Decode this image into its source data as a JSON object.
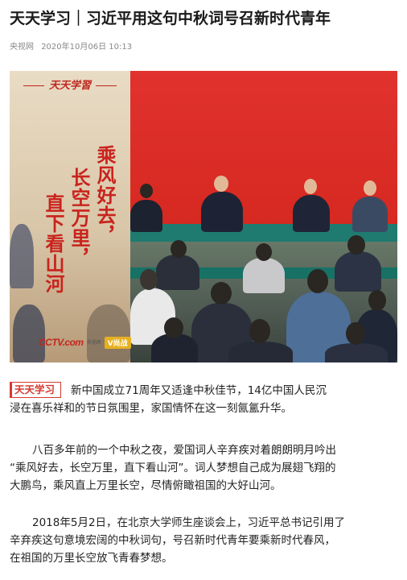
{
  "article": {
    "title": "天天学习｜习近平用这句中秋词号召新时代青年",
    "source": "央视网",
    "datetime": "2020年10月06日 10:13"
  },
  "hero": {
    "brand_text": "天天学習",
    "calligraphy_columns": [
      "乘风好去，",
      "长空万里，",
      "直下看山河"
    ],
    "logo_text": "CCTV.com",
    "logo_sub": "央视网",
    "badge_text": "V尚战",
    "colors": {
      "accent_red": "#d5281f",
      "tag_red": "#d63a2f"
    }
  },
  "body": {
    "tag_label": "天天学习",
    "paragraphs": [
      {
        "lines": [
          "新中国成立71周年又适逢中秋佳节，14亿中国人民沉",
          "浸在喜乐祥和的节日氛围里，家国情怀在这一刻氤氲升华。"
        ]
      },
      {
        "lines": [
          "八百多年前的一个中秋之夜，爱国词人辛弃疾对着朗朗明月吟出",
          "“乘风好去，长空万里，直下看山河”。词人梦想自己成为展翅飞翔的",
          "大鹏鸟，乘风直上万里长空，尽情俯瞰祖国的大好山河。"
        ]
      },
      {
        "lines": [
          "2018年5月2日，在北京大学师生座谈会上，习近平总书记引用了",
          "辛弃疾这句意境宏阔的中秋词句，号召新时代青年要乘新时代春风，",
          "在祖国的万里长空放飞青春梦想。"
        ]
      }
    ]
  }
}
